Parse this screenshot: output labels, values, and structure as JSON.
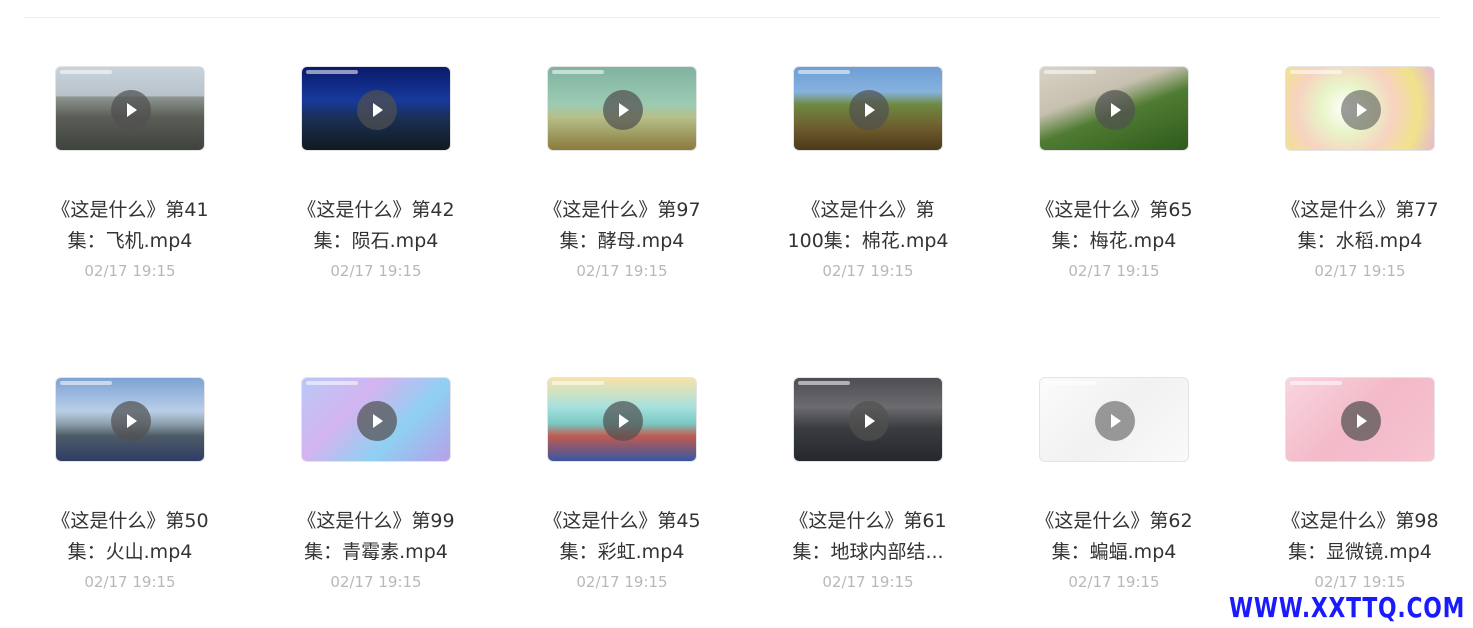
{
  "watermark": "WWW.XXTTQ.COM",
  "files": [
    {
      "title_line1": "《这是什么》第41",
      "title_line2": "集：飞机.mp4",
      "date": "02/17 19:15",
      "thumb": "airplane"
    },
    {
      "title_line1": "《这是什么》第42",
      "title_line2": "集：陨石.mp4",
      "date": "02/17 19:15",
      "thumb": "meteor"
    },
    {
      "title_line1": "《这是什么》第97",
      "title_line2": "集：酵母.mp4",
      "date": "02/17 19:15",
      "thumb": "yeast"
    },
    {
      "title_line1": "《这是什么》第",
      "title_line2": "100集：棉花.mp4",
      "date": "02/17 19:15",
      "thumb": "cotton"
    },
    {
      "title_line1": "《这是什么》第65",
      "title_line2": "集：梅花.mp4",
      "date": "02/17 19:15",
      "thumb": "plum"
    },
    {
      "title_line1": "《这是什么》第77",
      "title_line2": "集：水稻.mp4",
      "date": "02/17 19:15",
      "thumb": "rice"
    },
    {
      "title_line1": "《这是什么》第50",
      "title_line2": "集：火山.mp4",
      "date": "02/17 19:15",
      "thumb": "volcano"
    },
    {
      "title_line1": "《这是什么》第99",
      "title_line2": "集：青霉素.mp4",
      "date": "02/17 19:15",
      "thumb": "penicillin"
    },
    {
      "title_line1": "《这是什么》第45",
      "title_line2": "集：彩虹.mp4",
      "date": "02/17 19:15",
      "thumb": "rainbow"
    },
    {
      "title_line1": "《这是什么》第61",
      "title_line2": "集：地球内部结...",
      "date": "02/17 19:15",
      "thumb": "earth"
    },
    {
      "title_line1": "《这是什么》第62",
      "title_line2": "集：蝙蝠.mp4",
      "date": "02/17 19:15",
      "thumb": "bat"
    },
    {
      "title_line1": "《这是什么》第98",
      "title_line2": "集：显微镜.mp4",
      "date": "02/17 19:15",
      "thumb": "microscope"
    }
  ]
}
